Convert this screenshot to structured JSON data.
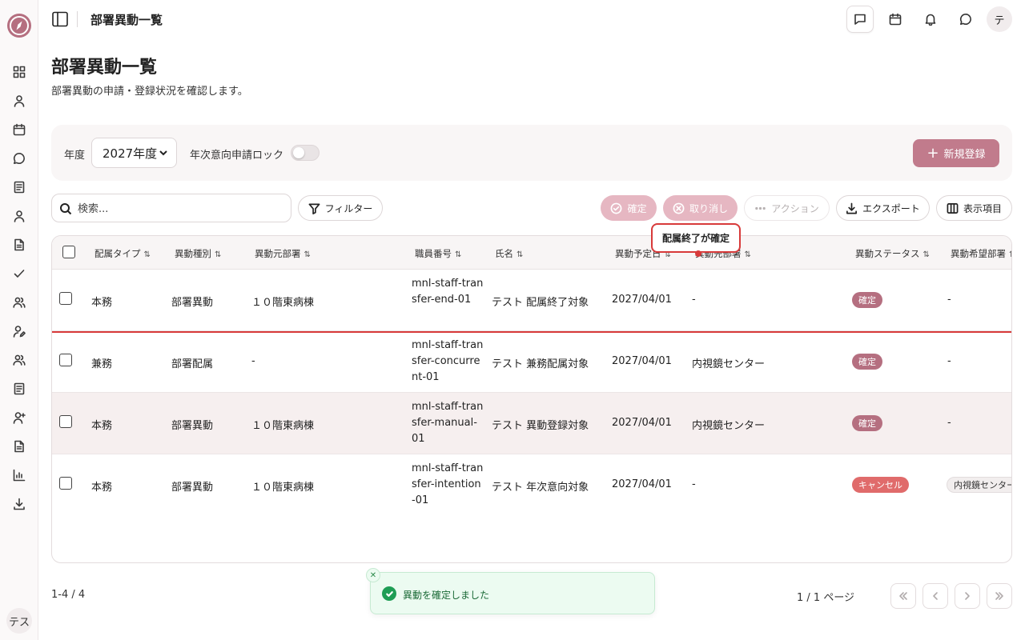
{
  "topbar": {
    "title": "部署異動一覧",
    "avatar": "テ"
  },
  "sidebar": {
    "avatar": "テス"
  },
  "header": {
    "title": "部署異動一覧",
    "subtitle": "部署異動の申請・登録状況を確認します。"
  },
  "filters": {
    "year_label": "年度",
    "year_value": "2027年度",
    "lock_label": "年次意向申請ロック",
    "lock_on": false,
    "new_button": "新規登録"
  },
  "toolbar": {
    "search_placeholder": "検索...",
    "filter": "フィルター",
    "confirm": "確定",
    "cancel": "取り消し",
    "actions": "アクション",
    "export": "エクスポート",
    "columns": "表示項目"
  },
  "table": {
    "headers": [
      "配属タイプ",
      "異動種別",
      "異動元部署",
      "職員番号",
      "氏名",
      "異動予定日",
      "異動先部署",
      "異動ステータス",
      "異動希望部署"
    ],
    "sort_glyph": "⇅",
    "rows": [
      {
        "type": "本務",
        "kind": "部署異動",
        "from": "１０階東病棟",
        "staff": "mnl-staff-transfer-end-01",
        "name": "テスト 配属終了対象",
        "date": "2027/04/01",
        "to": "-",
        "status": "確定",
        "wish": "-"
      },
      {
        "type": "兼務",
        "kind": "部署配属",
        "from": "-",
        "staff": "mnl-staff-transfer-concurrent-01",
        "name": "テスト 兼務配属対象",
        "date": "2027/04/01",
        "to": "内視鏡センター",
        "status": "確定",
        "wish": "-"
      },
      {
        "type": "本務",
        "kind": "部署異動",
        "from": "１０階東病棟",
        "staff": "mnl-staff-transfer-manual-01",
        "name": "テスト 異動登録対象",
        "date": "2027/04/01",
        "to": "内視鏡センター",
        "status": "確定",
        "wish": "-"
      },
      {
        "type": "本務",
        "kind": "部署異動",
        "from": "１０階東病棟",
        "staff": "mnl-staff-transfer-intention-01",
        "name": "テスト 年次意向対象",
        "date": "2027/04/01",
        "to": "-",
        "status": "キャンセル",
        "wish": "内視鏡センター"
      }
    ]
  },
  "tooltip": "配属終了が確定",
  "footer": {
    "range": "1-4 / 4",
    "page": "1 / 1 ページ"
  },
  "toast": {
    "message": "異動を確定しました"
  },
  "colors": {
    "accent": "#c17b8c",
    "status_ok": "#b56f80",
    "status_cancel": "#e06b6b",
    "alert": "#d83a3a",
    "success": "#1f9d55"
  }
}
